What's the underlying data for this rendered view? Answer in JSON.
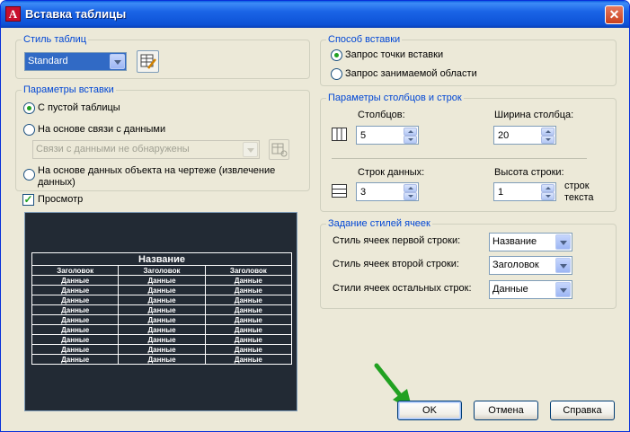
{
  "window": {
    "title": "Вставка таблицы",
    "close_glyph": "✕",
    "app_icon_letter": "A"
  },
  "table_style": {
    "group_title": "Стиль таблиц",
    "selected": "Standard",
    "edit_icon": "table-style-edit-icon"
  },
  "insert_options": {
    "group_title": "Параметры вставки",
    "empty_table": "С пустой таблицы",
    "from_data_link": "На основе связи с данными",
    "data_link_value": "Связи с данными не обнаружены",
    "from_object_data": "На основе данных объекта на чертеже (извлечение данных)"
  },
  "preview": {
    "checkbox_label": "Просмотр",
    "checked": true,
    "table_title": "Название",
    "headers": [
      "Заголовок",
      "Заголовок",
      "Заголовок"
    ],
    "data_cell": "Данные",
    "data_rows": 9
  },
  "insertion_method": {
    "group_title": "Способ вставки",
    "specify_point": "Запрос точки вставки",
    "specify_window": "Запрос занимаемой области"
  },
  "columns_rows": {
    "group_title": "Параметры столбцов и строк",
    "columns_label": "Столбцов:",
    "columns_value": "5",
    "column_width_label": "Ширина столбца:",
    "column_width_value": "20",
    "data_rows_label": "Строк данных:",
    "data_rows_value": "3",
    "row_height_label": "Высота строки:",
    "row_height_value": "1",
    "row_height_unit": "строк текста"
  },
  "cell_styles": {
    "group_title": "Задание стилей ячеек",
    "first_row_label": "Стиль ячеек первой строки:",
    "first_row_value": "Название",
    "second_row_label": "Стиль ячеек второй строки:",
    "second_row_value": "Заголовок",
    "other_rows_label": "Стили ячеек остальных строк:",
    "other_rows_value": "Данные"
  },
  "buttons": {
    "ok": "OK",
    "cancel": "Отмена",
    "help": "Справка"
  },
  "colors": {
    "accent_green": "#21a121",
    "group_title": "#0046d5",
    "titlebar": "#0a5fe0",
    "preview_bg": "#222a34"
  }
}
